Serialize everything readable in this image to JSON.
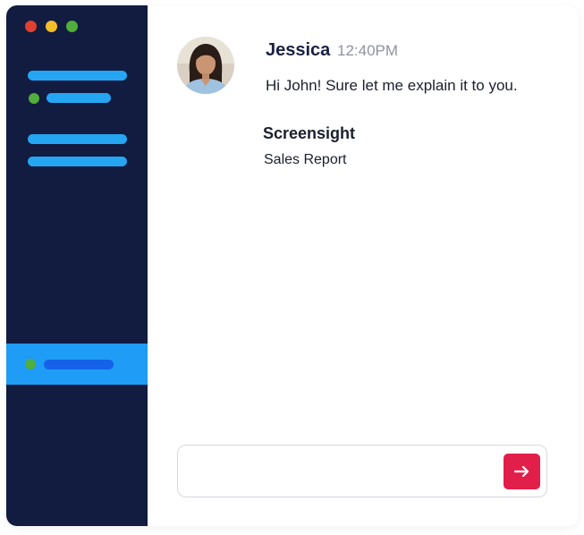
{
  "window_controls": {
    "close_color": "#e0402f",
    "minimize_color": "#f2bd2a",
    "maximize_color": "#4fae3c"
  },
  "sidebar": {
    "background": "#121b40",
    "accent": "#24a6f2",
    "active_item_color": "#1f9cf5",
    "online_dot_color": "#4fae3c"
  },
  "message": {
    "avatar": "avatar-photo",
    "sender": "Jessica",
    "time": "12:40PM",
    "text": "Hi John! Sure let me explain it to you."
  },
  "attachment": {
    "title": "Screensight",
    "subtitle": "Sales Report"
  },
  "composer": {
    "input_value": "",
    "send_icon": "arrow-right-icon",
    "send_color": "#e21f4a"
  }
}
